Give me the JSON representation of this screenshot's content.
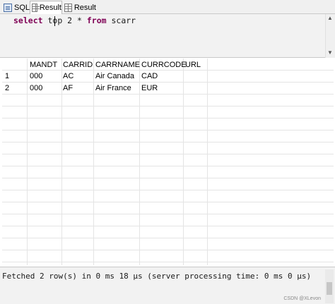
{
  "tabs": [
    {
      "label": "SQL",
      "icon": "sql-icon"
    },
    {
      "label": "Result",
      "icon": "result-grid-icon",
      "active": true
    },
    {
      "label": "Result",
      "icon": "result-grid-icon"
    }
  ],
  "editor": {
    "keyword1": "select",
    "mid": " top 2 * ",
    "keyword2": "from",
    "tail": " scarr"
  },
  "grid": {
    "columns": [
      "MANDT",
      "CARRID",
      "CARRNAME",
      "CURRCODE",
      "URL"
    ],
    "rows": [
      {
        "num": "1",
        "cells": [
          "000",
          "AC",
          "Air Canada",
          "CAD",
          ""
        ]
      },
      {
        "num": "2",
        "cells": [
          "000",
          "AF",
          "Air France",
          "EUR",
          ""
        ]
      }
    ]
  },
  "messages": {
    "text": "Fetched 2 row(s) in 0 ms 18 µs (server processing time: 0 ms 0 µs)"
  },
  "watermark": "CSDN @XLevon"
}
